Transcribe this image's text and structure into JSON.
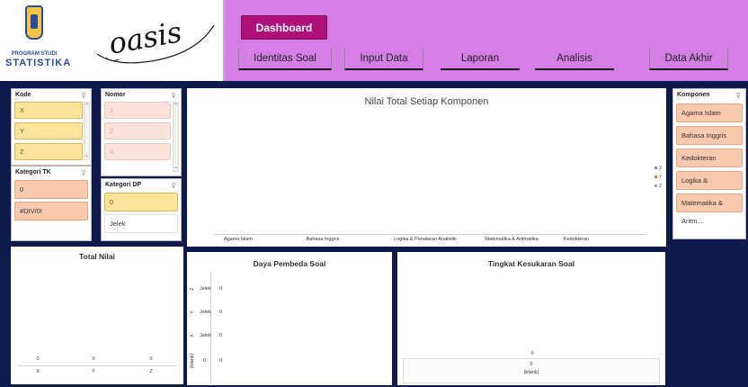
{
  "header": {
    "program_label": "PROGRAM STUDI",
    "program_name": "STATISTIKA",
    "university_line": "",
    "logo_text": "oasis",
    "dashboard_label": "Dashboard",
    "nav": [
      "Identitas Soal",
      "Input Data",
      "Laporan",
      "Analisis",
      "Data Akhir"
    ]
  },
  "colors": {
    "header_bg": "#d57ee6",
    "page_bg": "#0e1a4c",
    "dashboard_accent": "#b0107a",
    "slicer_selected": "#fde49a",
    "slicer_peach": "#f8c9ac"
  },
  "slicers": {
    "kode": {
      "title": "Kode",
      "items": [
        "X",
        "Y",
        "Z"
      ]
    },
    "nomor": {
      "title": "Nomor",
      "items": [
        "1",
        "2",
        "3"
      ]
    },
    "kategori_tk": {
      "title": "Kategori TK",
      "items": [
        "0",
        "#DIV/0!"
      ]
    },
    "kategori_dp": {
      "title": "Kategori DP",
      "items": [
        "0",
        "Jelek"
      ]
    },
    "komponen": {
      "title": "Komponen",
      "items": [
        "Agama Islam",
        "Bahasa Inggris",
        "Kedokteran",
        "Logika & Penalaran...",
        "Matematika & Aritm..."
      ]
    }
  },
  "main_chart": {
    "title": "Nilai Total Setiap Komponen",
    "categories": [
      "Agama Islam",
      "Bahasa Inggris",
      "Logika & Penalaran Analistik",
      "Matematika & Aritmatika",
      "Kedokteran"
    ],
    "legend": [
      "X",
      "Y",
      "Z"
    ]
  },
  "total_nilai": {
    "title": "Total Nilai",
    "categories": [
      "X",
      "Y",
      "Z"
    ],
    "values": [
      "0",
      "0",
      "0"
    ]
  },
  "daya_pembeda": {
    "title": "Daya Pembeda Soal",
    "rows": [
      {
        "code": "Z",
        "label": "Jelek",
        "value": "0"
      },
      {
        "code": "Y",
        "label": "Jelek",
        "value": "0"
      },
      {
        "code": "X",
        "label": "Jelek",
        "value": "0"
      },
      {
        "code": "(blank)",
        "label": "0",
        "value": "0"
      }
    ]
  },
  "tingkat_kesukaran": {
    "title": "Tingkat Kesukaran Soal",
    "top_value": "0",
    "inner_value": "0",
    "inner_label": "(blank)"
  },
  "chart_data": [
    {
      "type": "bar",
      "title": "Nilai Total Setiap Komponen",
      "categories": [
        "Agama Islam",
        "Bahasa Inggris",
        "Logika & Penalaran Analistik",
        "Matematika & Aritmatika",
        "Kedokteran"
      ],
      "series": [
        {
          "name": "X",
          "values": [
            0,
            0,
            0,
            0,
            0
          ]
        },
        {
          "name": "Y",
          "values": [
            0,
            0,
            0,
            0,
            0
          ]
        },
        {
          "name": "Z",
          "values": [
            0,
            0,
            0,
            0,
            0
          ]
        }
      ],
      "legend": "right"
    },
    {
      "type": "bar",
      "title": "Total Nilai",
      "categories": [
        "X",
        "Y",
        "Z"
      ],
      "values": [
        0,
        0,
        0
      ]
    },
    {
      "type": "bar",
      "title": "Daya Pembeda Soal",
      "categories": [
        "Z Jelek",
        "Y Jelek",
        "X Jelek",
        "(blank) 0"
      ],
      "values": [
        0,
        0,
        0,
        0
      ]
    },
    {
      "type": "bar",
      "title": "Tingkat Kesukaran Soal",
      "categories": [
        "(blank)"
      ],
      "values": [
        0
      ]
    }
  ]
}
